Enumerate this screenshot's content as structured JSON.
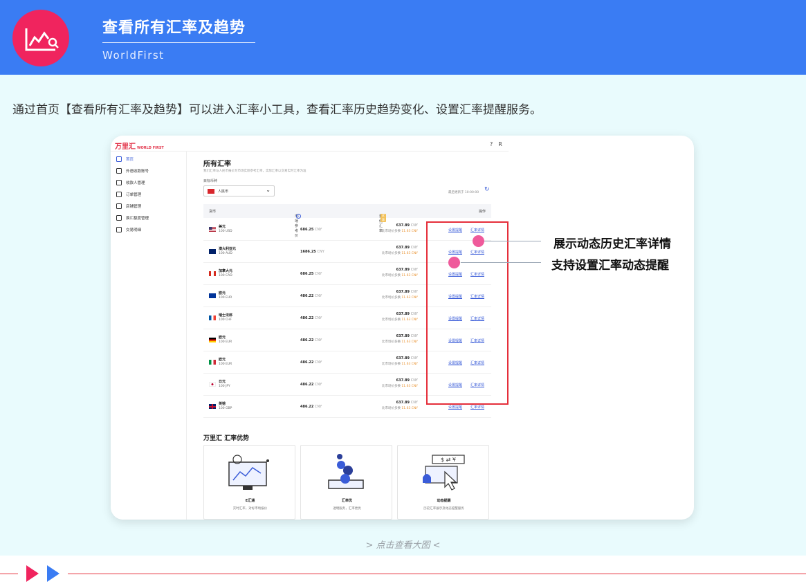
{
  "banner": {
    "title": "查看所有汇率及趋势",
    "subtitle": "WorldFirst",
    "icon": "chart-magnifier-icon",
    "colors": {
      "banner_bg": "#3a7cf3",
      "logo_bg": "#f0245e"
    }
  },
  "intro": "通过首页【查看所有汇率及趋势】可以进入汇率小工具，查看汇率历史趋势变化、设置汇率提醒服务。",
  "screenshot": {
    "brand": "万里汇",
    "brand_small": "WORLD FIRST",
    "top_icons": [
      "help-icon",
      "user-icon"
    ],
    "top_icon_glyphs": [
      "?",
      "R"
    ],
    "sidebar": [
      {
        "label": "首页",
        "icon": "home-icon",
        "active": true
      },
      {
        "label": "外语收款账号",
        "icon": "bank-icon"
      },
      {
        "label": "收款人管理",
        "icon": "user-icon"
      },
      {
        "label": "订单管理",
        "icon": "list-icon"
      },
      {
        "label": "店铺管理",
        "icon": "store-icon"
      },
      {
        "label": "换汇额度管理",
        "icon": "exchange-icon"
      },
      {
        "label": "交易明细",
        "icon": "doc-icon"
      }
    ],
    "main": {
      "title": "所有汇率",
      "desc": "我们汇率与人民币报价为市场实际参考汇率，实际汇率以交易实时汇率为准",
      "currency_label": "目标币种",
      "currency_value": "人民币",
      "updated": "最后更新于 10:00:00",
      "columns": {
        "currency": "货币",
        "market": "市场参考价",
        "ours": "我们汇率",
        "ours_tag": "优惠",
        "actions": "操作"
      },
      "rows": [
        {
          "flag": "us",
          "name": "美元",
          "amount": "100 USD",
          "market": "686.25",
          "market_unit": "CNY",
          "rate": "637.89",
          "rate_unit": "CNY",
          "save_prefix": "比市场价多换",
          "save": "11.63 CNY",
          "alert": "设置提醒",
          "detail": "汇率详情"
        },
        {
          "flag": "au",
          "name": "澳大利亚元",
          "amount": "100 AUD",
          "market": "1686.25",
          "market_unit": "CNY",
          "rate": "637.89",
          "rate_unit": "CNY",
          "save_prefix": "比市场价多换",
          "save": "11.63 CNY",
          "alert": "设置提醒",
          "detail": "汇率详情"
        },
        {
          "flag": "ca",
          "name": "加拿大元",
          "amount": "100 CAD",
          "market": "686.25",
          "market_unit": "CNY",
          "rate": "637.89",
          "rate_unit": "CNY",
          "save_prefix": "比市场价多换",
          "save": "11.63 CNY",
          "alert": "设置提醒",
          "detail": "汇率详情"
        },
        {
          "flag": "eu",
          "name": "欧元",
          "amount": "100 EUR",
          "market": "486.22",
          "market_unit": "CNY",
          "rate": "637.89",
          "rate_unit": "CNY",
          "save_prefix": "比市场价多换",
          "save": "11.63 CNY",
          "alert": "设置提醒",
          "detail": "汇率详情"
        },
        {
          "flag": "fr",
          "name": "瑞士法郎",
          "amount": "100 CHF",
          "market": "486.22",
          "market_unit": "CNY",
          "rate": "637.89",
          "rate_unit": "CNY",
          "save_prefix": "比市场价多换",
          "save": "11.63 CNY",
          "alert": "设置提醒",
          "detail": "汇率详情"
        },
        {
          "flag": "de",
          "name": "欧元",
          "amount": "100 EUR",
          "market": "486.22",
          "market_unit": "CNY",
          "rate": "637.89",
          "rate_unit": "CNY",
          "save_prefix": "比市场价多换",
          "save": "11.63 CNY",
          "alert": "设置提醒",
          "detail": "汇率详情"
        },
        {
          "flag": "it",
          "name": "欧元",
          "amount": "100 EUR",
          "market": "486.22",
          "market_unit": "CNY",
          "rate": "637.89",
          "rate_unit": "CNY",
          "save_prefix": "比市场价多换",
          "save": "11.63 CNY",
          "alert": "设置提醒",
          "detail": "汇率详情"
        },
        {
          "flag": "jp",
          "name": "日元",
          "amount": "100 JPY",
          "market": "486.22",
          "market_unit": "CNY",
          "rate": "637.89",
          "rate_unit": "CNY",
          "save_prefix": "比市场价多换",
          "save": "11.63 CNY",
          "alert": "设置提醒",
          "detail": "汇率详情"
        },
        {
          "flag": "gb",
          "name": "英镑",
          "amount": "100 GBP",
          "market": "486.22",
          "market_unit": "CNY",
          "rate": "637.89",
          "rate_unit": "CNY",
          "save_prefix": "比市场价多换",
          "save": "11.63 CNY",
          "alert": "设置提醒",
          "detail": "汇率详情"
        }
      ],
      "advantages_title": "万里汇 汇率优势",
      "advantages": [
        {
          "name": "E汇通",
          "desc": "实时汇率，对标市场报价",
          "icon": "monitor-chart-icon"
        },
        {
          "name": "汇率优",
          "desc": "透明服务，汇率更优",
          "icon": "coins-icon"
        },
        {
          "name": "动态提醒",
          "desc": "历史汇率展示及动态提醒服务",
          "icon": "bell-alert-icon"
        }
      ]
    }
  },
  "annotations": {
    "callout_1": "展示动态历史汇率详情",
    "callout_2": "支持设置汇率动态提醒",
    "colors": {
      "box": "#e52e3a",
      "dot": "#ef5a9b"
    }
  },
  "enlarge": "> 点击查看大图 <",
  "footer": {
    "colors": {
      "line": "#e52e3a",
      "arrow_1": "#f0245e",
      "arrow_2": "#3a7cf3"
    }
  }
}
